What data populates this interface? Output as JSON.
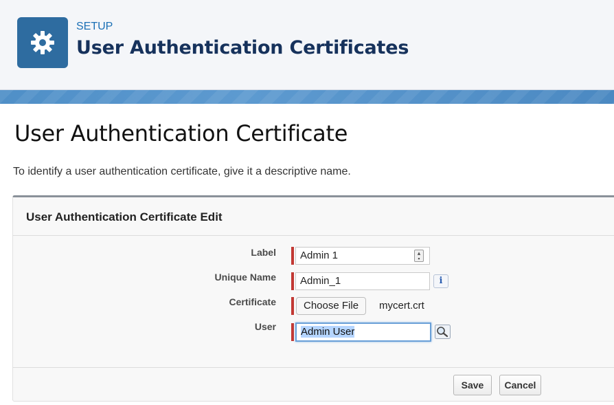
{
  "header": {
    "eyebrow": "SETUP",
    "title": "User Authentication Certificates",
    "icon": "gear-icon",
    "icon_bg": "#2e6ca0"
  },
  "page": {
    "heading": "User Authentication Certificate",
    "description": "To identify a user authentication certificate, give it a descriptive name."
  },
  "panel": {
    "title": "User Authentication Certificate Edit"
  },
  "form": {
    "label": {
      "label": "Label",
      "value": "Admin 1"
    },
    "unique_name": {
      "label": "Unique Name",
      "value": "Admin_1",
      "info": "i"
    },
    "certificate": {
      "label": "Certificate",
      "button": "Choose File",
      "file": "mycert.crt"
    },
    "user": {
      "label": "User",
      "value": "Admin User",
      "lookup_icon": "lookup-magnifier-icon"
    }
  },
  "buttons": {
    "save": "Save",
    "cancel": "Cancel"
  },
  "colors": {
    "required_bar": "#c23934",
    "accent": "#1a6fb5"
  }
}
